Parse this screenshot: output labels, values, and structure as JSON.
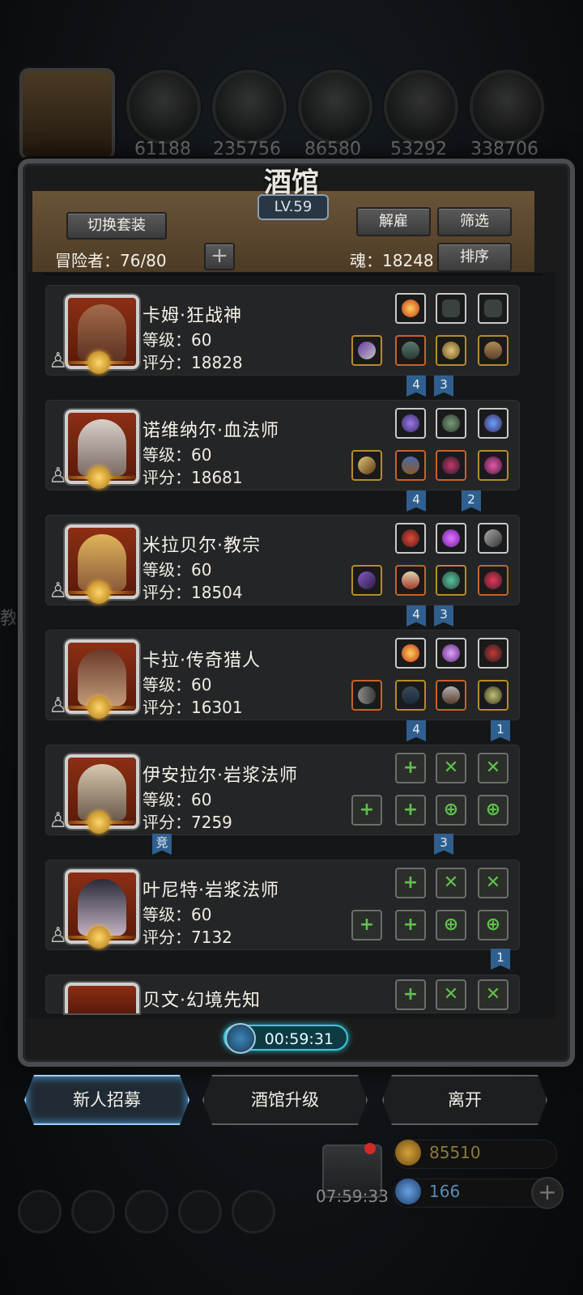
{
  "top_resources": [
    {
      "name": "hero-slot",
      "value": ""
    },
    {
      "name": "meat",
      "value": "61188"
    },
    {
      "name": "wood",
      "value": "235756"
    },
    {
      "name": "iron",
      "value": "86580"
    },
    {
      "name": "crystal",
      "value": "53292"
    },
    {
      "name": "stone",
      "value": "338706"
    }
  ],
  "tavern": {
    "title": "酒馆",
    "level": "LV.59",
    "switch_outfit": "切换套装",
    "dismiss": "解雇",
    "filter": "筛选",
    "sort": "排序",
    "adventurers_label": "冒险者：76/80",
    "soul_label": "魂：18248",
    "add": "+"
  },
  "heroes": [
    {
      "name": "卡姆·狂战神",
      "level": "等级：60",
      "score": "评分：18828",
      "ribbons": [
        "4",
        "3"
      ]
    },
    {
      "name": "诺维纳尔·血法师",
      "level": "等级：60",
      "score": "评分：18681",
      "ribbons": [
        "4",
        "2"
      ]
    },
    {
      "name": "米拉贝尔·教宗",
      "level": "等级：60",
      "score": "评分：18504",
      "ribbons": [
        "4",
        "3"
      ]
    },
    {
      "name": "卡拉·传奇猎人",
      "level": "等级：60",
      "score": "评分：16301",
      "ribbons": [
        "4",
        "1"
      ]
    },
    {
      "name": "伊安拉尔·岩浆法师",
      "level": "等级：60",
      "score": "评分：7259",
      "ribbons": [
        "竞",
        "3"
      ]
    },
    {
      "name": "叶尼特·岩浆法师",
      "level": "等级：60",
      "score": "评分：7132",
      "ribbons": [
        "1"
      ]
    },
    {
      "name": "贝文·幻境先知",
      "level": "",
      "score": "",
      "ribbons": []
    }
  ],
  "timer": "00:59:31",
  "actions": {
    "recruit": "新人招募",
    "upgrade": "酒馆升级",
    "leave": "离开"
  },
  "footer": {
    "gift_timer": "07:59:33",
    "gold": "85510",
    "gems": "166"
  },
  "side_label": "教",
  "colors": {
    "accent": "#3ec7d6",
    "ribbon": "#2f5f8f",
    "gold": "#e0a62a",
    "plus": "#5fc24a"
  }
}
